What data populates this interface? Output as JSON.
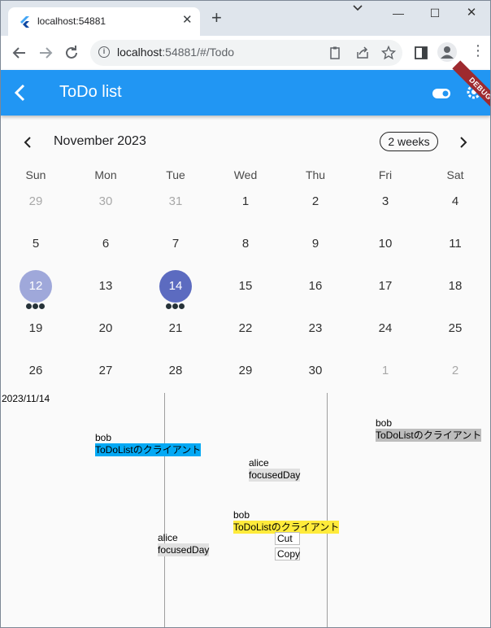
{
  "browser": {
    "tab_title": "localhost:54881",
    "tab_close": "✕",
    "new_tab": "+",
    "url_host": "localhost",
    "url_rest": ":54881/#/Todo",
    "win_min": "—",
    "win_max": "☐",
    "win_close": "✕"
  },
  "app": {
    "title": "ToDo list",
    "debug_banner": "DEBUG",
    "accent": "#2196f3"
  },
  "calendar": {
    "month_label": "November 2023",
    "format_button": "2 weeks",
    "weekdays": [
      "Sun",
      "Mon",
      "Tue",
      "Wed",
      "Thu",
      "Fri",
      "Sat"
    ],
    "weeks": [
      [
        "29",
        "30",
        "31",
        "1",
        "2",
        "3",
        "4"
      ],
      [
        "5",
        "6",
        "7",
        "8",
        "9",
        "10",
        "11"
      ],
      [
        "12",
        "13",
        "14",
        "15",
        "16",
        "17",
        "18"
      ],
      [
        "19",
        "20",
        "21",
        "22",
        "23",
        "24",
        "25"
      ],
      [
        "26",
        "27",
        "28",
        "29",
        "30",
        "1",
        "2"
      ]
    ],
    "today": "12",
    "selected": "14"
  },
  "timeline": {
    "date_label": "2023/11/14",
    "notes": [
      {
        "author": "bob",
        "text": "ToDoListのクライアント",
        "color": "#03a9f4"
      },
      {
        "author": "alice",
        "text": "focusedDay",
        "color": "#e0e0e0"
      },
      {
        "author": "bob",
        "text": "ToDoListのクライアント",
        "color": "#ffeb3b"
      },
      {
        "author": "alice",
        "text": "focusedDay",
        "color": "#e0e0e0"
      },
      {
        "author": "bob",
        "text": "ToDoListのクライアント",
        "color": "#bdbdbd"
      }
    ],
    "context_menu": {
      "cut": "Cut",
      "copy": "Copy"
    }
  }
}
